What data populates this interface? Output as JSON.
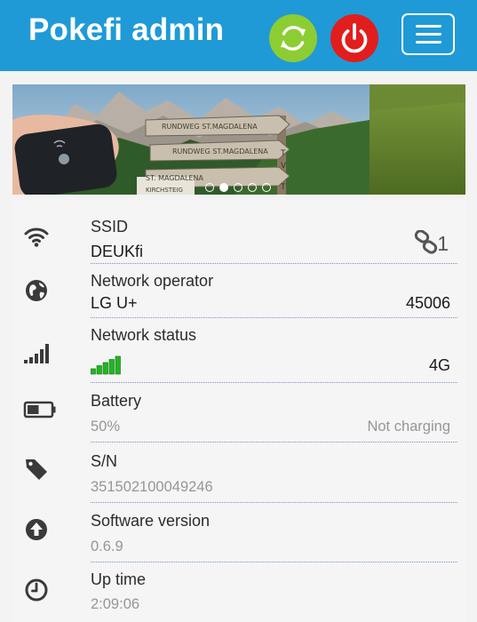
{
  "header": {
    "title": "Pokefi admin",
    "restart_color": "#8ccd33",
    "power_color": "#e21d1d",
    "bar_color": "#1f9ad6"
  },
  "banner": {
    "slides_total": 5,
    "active_slide_index": 1,
    "signpost_lines": [
      "RUNDWEG ST.MAGDALENA",
      "RUNDWEG ST.MAGDALENA",
      "ST. MAGDALENA",
      "KIRCHSTEIG"
    ],
    "signpost_side_letters": [
      "T",
      "V",
      "T"
    ]
  },
  "status": {
    "ssid": {
      "label": "SSID",
      "value": "DEUKfi",
      "connected_count": "1",
      "icon": "wifi-icon"
    },
    "operator": {
      "label": "Network operator",
      "value": "LG U+",
      "code": "45006",
      "icon": "globe-icon"
    },
    "network": {
      "label": "Network status",
      "type": "4G",
      "signal_bars_filled": 5,
      "signal_bars_total": 5,
      "signal_color": "#22b522",
      "icon": "signal-icon"
    },
    "battery": {
      "label": "Battery",
      "value": "50%",
      "charging_state": "Not charging",
      "level_fraction": 0.5,
      "icon": "battery-icon"
    },
    "serial": {
      "label": "S/N",
      "value": "351502100049246",
      "icon": "tag-icon"
    },
    "software": {
      "label": "Software version",
      "value": "0.6.9",
      "icon": "upload-icon"
    },
    "uptime": {
      "label": "Up time",
      "value": "2:09:06",
      "icon": "clock-icon"
    }
  }
}
